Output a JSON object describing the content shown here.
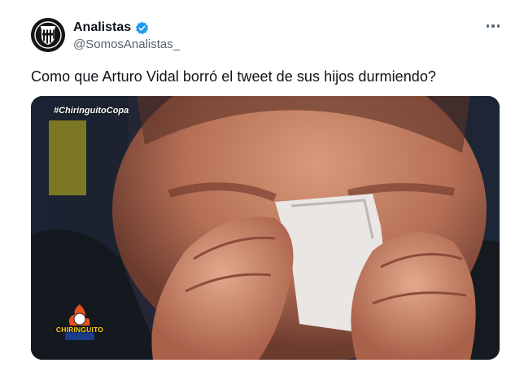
{
  "author": {
    "display_name": "Analistas",
    "handle": "@SomosAnalistas_",
    "verified": true,
    "avatar_icon": "juventus-style-crest-icon"
  },
  "tweet": {
    "text": "Como que Arturo Vidal borró el tweet de sus hijos durmiendo?"
  },
  "media": {
    "hashtag": "#ChiringuitoCopa",
    "logo_text": "CHIRINGUITO",
    "description_icon": "photo-man-crying-with-tissue"
  },
  "colors": {
    "verified_blue": "#1d9bf0",
    "text_primary": "#0f1419",
    "text_secondary": "#536471",
    "logo_yellow": "#ffd21a"
  }
}
